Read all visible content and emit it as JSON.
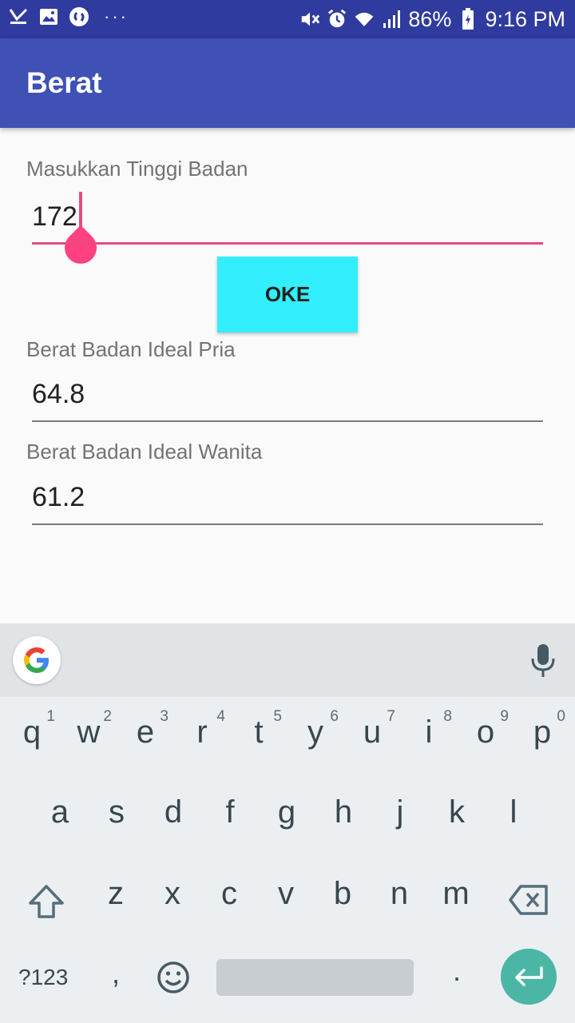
{
  "status_bar": {
    "battery": "86%",
    "time": "9:16 PM",
    "dots": "···",
    "left_icons": [
      "check-icon",
      "image-icon",
      "shazam-icon"
    ],
    "right_icons": [
      "mute-icon",
      "alarm-icon",
      "wifi-icon",
      "signal-icon",
      "battery-icon"
    ]
  },
  "app_bar": {
    "title": "Berat"
  },
  "form": {
    "height_label": "Masukkan Tinggi Badan",
    "height_value": "172",
    "button_label": "OKE",
    "male_label": "Berat Badan Ideal Pria",
    "male_value": "64.8",
    "female_label": "Berat Badan Ideal Wanita",
    "female_value": "61.2"
  },
  "keyboard": {
    "row1": [
      {
        "ch": "q",
        "num": "1"
      },
      {
        "ch": "w",
        "num": "2"
      },
      {
        "ch": "e",
        "num": "3"
      },
      {
        "ch": "r",
        "num": "4"
      },
      {
        "ch": "t",
        "num": "5"
      },
      {
        "ch": "y",
        "num": "6"
      },
      {
        "ch": "u",
        "num": "7"
      },
      {
        "ch": "i",
        "num": "8"
      },
      {
        "ch": "o",
        "num": "9"
      },
      {
        "ch": "p",
        "num": "0"
      }
    ],
    "row2": [
      "a",
      "s",
      "d",
      "f",
      "g",
      "h",
      "j",
      "k",
      "l"
    ],
    "row3": [
      "z",
      "x",
      "c",
      "v",
      "b",
      "n",
      "m"
    ],
    "symbols_label": "?123",
    "comma": ",",
    "period": "."
  },
  "colors": {
    "status_bar": "#2f3b9e",
    "app_bar": "#3f51b5",
    "accent": "#ff4081",
    "button": "#33eefd",
    "enter_key": "#4cb6a6"
  }
}
